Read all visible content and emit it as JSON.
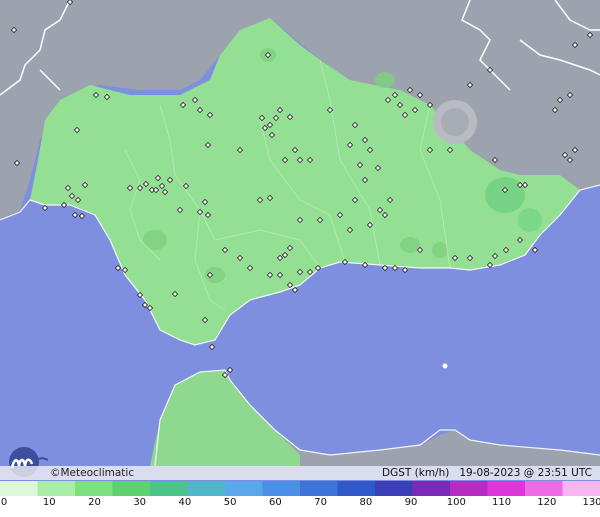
{
  "brand": {
    "copyright": "©Meteoclimatic"
  },
  "footer": {
    "variable": "DGST (km/h)",
    "date": "19-08-2023",
    "time": "@ 23:51 UTC"
  },
  "scale": {
    "labels": [
      "0",
      "10",
      "20",
      "30",
      "40",
      "50",
      "60",
      "70",
      "80",
      "90",
      "100",
      "110",
      "120",
      "130"
    ],
    "colors": [
      "#dcf7dc",
      "#a8eea8",
      "#7ee07e",
      "#5fd06f",
      "#4cc38a",
      "#4fb7c9",
      "#5aa7ea",
      "#4b8fe6",
      "#3c74d8",
      "#2f59c8",
      "#3b3fb8",
      "#7a2ab6",
      "#b52cc2",
      "#dc37d8",
      "#ee6be6",
      "#f7b6f0"
    ]
  },
  "map": {
    "colors": {
      "sea": "#7f8fe0",
      "land_outside": "#9ca3ae",
      "region": "#93df93",
      "region_dark": "#7fd07f",
      "calm": "#b8bcc2"
    }
  }
}
